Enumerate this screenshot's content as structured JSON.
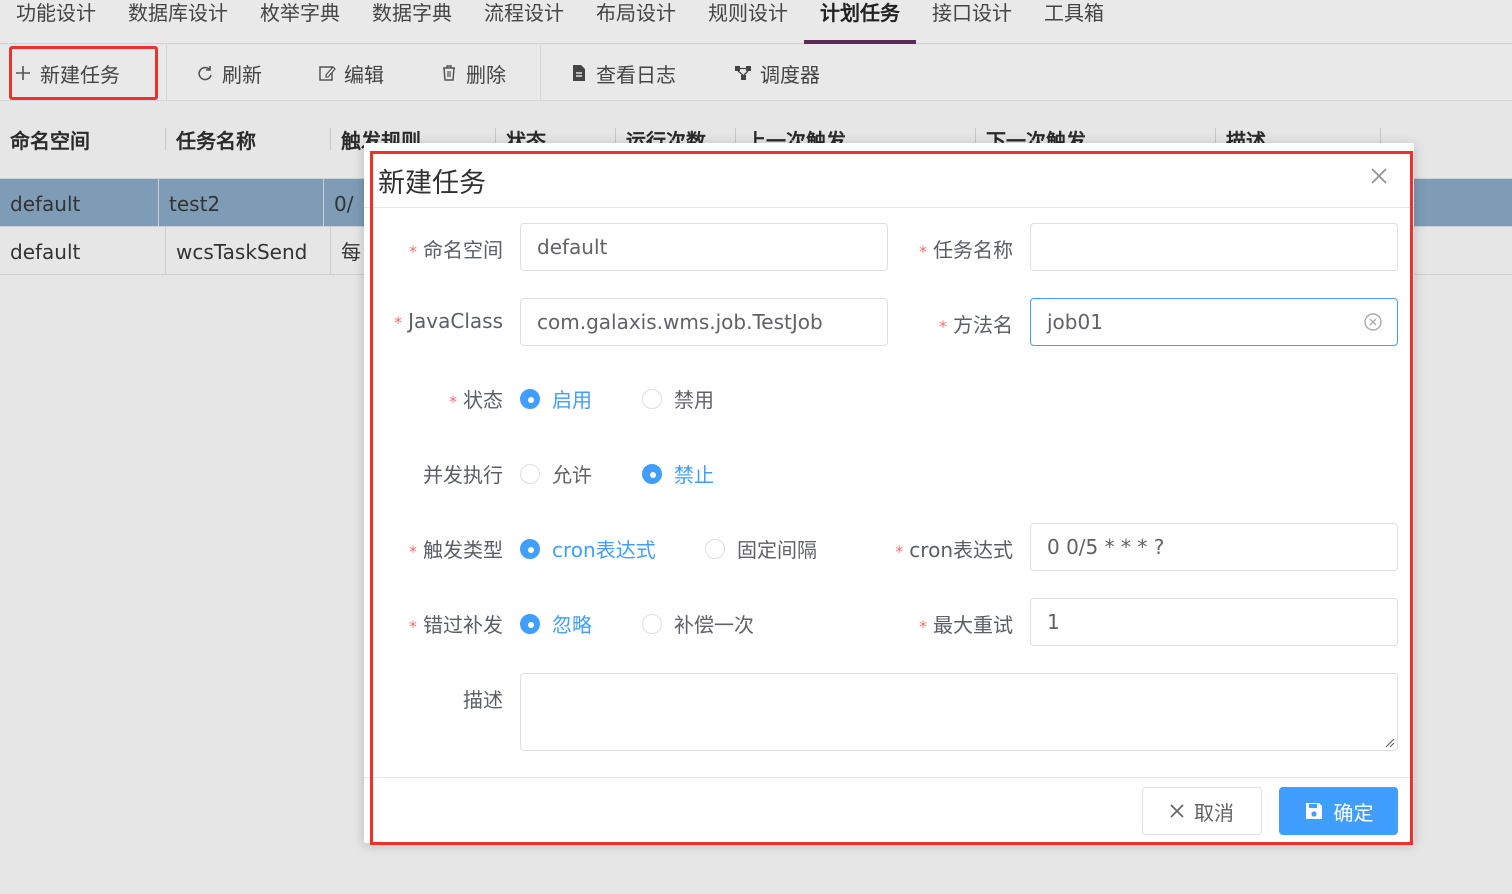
{
  "topnav": {
    "tabs": [
      {
        "label": "功能设计"
      },
      {
        "label": "数据库设计"
      },
      {
        "label": "枚举字典"
      },
      {
        "label": "数据字典"
      },
      {
        "label": "流程设计"
      },
      {
        "label": "布局设计"
      },
      {
        "label": "规则设计"
      },
      {
        "label": "计划任务",
        "active": true
      },
      {
        "label": "接口设计"
      },
      {
        "label": "工具箱"
      }
    ]
  },
  "toolbar": {
    "new_task": "新建任务",
    "refresh": "刷新",
    "edit": "编辑",
    "delete": "删除",
    "view_log": "查看日志",
    "scheduler": "调度器"
  },
  "table": {
    "columns": [
      "命名空间",
      "任务名称",
      "触发规则",
      "状态",
      "运行次数",
      "上一次触发",
      "下一次触发",
      "描述"
    ],
    "rows": [
      {
        "namespace": "default",
        "task_name": "test2",
        "trigger": "0/",
        "selected": true
      },
      {
        "namespace": "default",
        "task_name": "wcsTaskSend",
        "trigger": "每",
        "selected": false
      }
    ]
  },
  "dialog": {
    "title": "新建任务",
    "fields": {
      "namespace": {
        "label": "命名空间",
        "value": "default"
      },
      "task_name": {
        "label": "任务名称",
        "value": ""
      },
      "java_class": {
        "label": "JavaClass",
        "value": "com.galaxis.wms.job.TestJob"
      },
      "method": {
        "label": "方法名",
        "value": "job01"
      },
      "status": {
        "label": "状态",
        "options": [
          "启用",
          "禁用"
        ],
        "selected": "启用"
      },
      "concurrent": {
        "label": "并发执行",
        "options": [
          "允许",
          "禁止"
        ],
        "selected": "禁止"
      },
      "trigger_type": {
        "label": "触发类型",
        "options": [
          "cron表达式",
          "固定间隔"
        ],
        "selected": "cron表达式"
      },
      "cron": {
        "label": "cron表达式",
        "value": "0 0/5 * * * ?"
      },
      "misfire": {
        "label": "错过补发",
        "options": [
          "忽略",
          "补偿一次"
        ],
        "selected": "忽略"
      },
      "max_retry": {
        "label": "最大重试",
        "value": "1"
      },
      "description": {
        "label": "描述",
        "value": ""
      }
    },
    "buttons": {
      "cancel": "取消",
      "ok": "确定"
    }
  },
  "colors": {
    "primary": "#409eff",
    "highlight": "#f0302a",
    "active_tab": "#5a2b57",
    "required": "#f56c6c",
    "selected_row": "#7e9cb5"
  }
}
